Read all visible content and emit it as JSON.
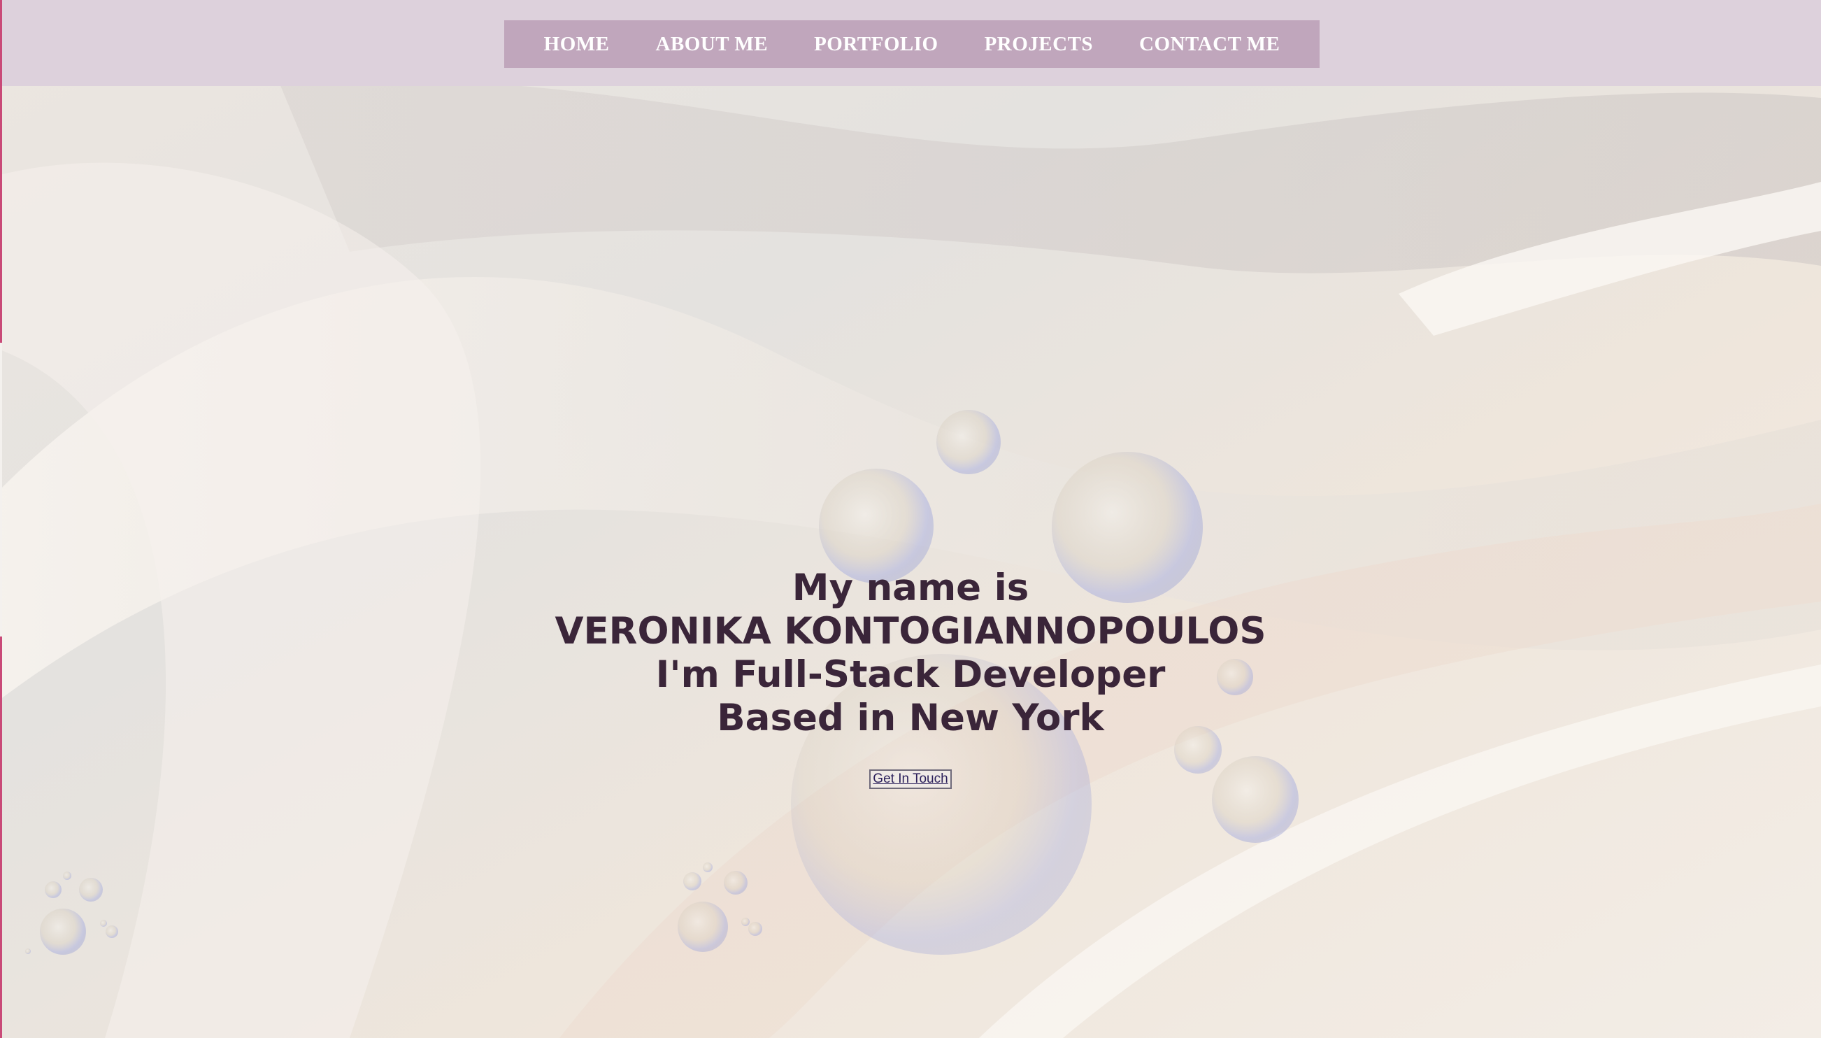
{
  "nav": {
    "items": [
      {
        "label": "HOME"
      },
      {
        "label": "ABOUT ME"
      },
      {
        "label": "PORTFOLIO"
      },
      {
        "label": "PROJECTS"
      },
      {
        "label": "CONTACT ME"
      }
    ]
  },
  "hero": {
    "line1": "My name is",
    "line2": "VERONIKA KONTOGIANNOPOULOS",
    "line3": "I'm Full-Stack Developer",
    "line4": "Based in New York",
    "cta_label": "Get In Touch"
  },
  "colors": {
    "navbar_bg": "#ddd1dc",
    "nav_box_bg": "#c0a6bc",
    "nav_text": "#ffffff",
    "hero_text": "#3a2539",
    "accent_edge": "#c94a78"
  },
  "icons": {
    "background": "iridescent-waves-with-bubbles-image"
  }
}
